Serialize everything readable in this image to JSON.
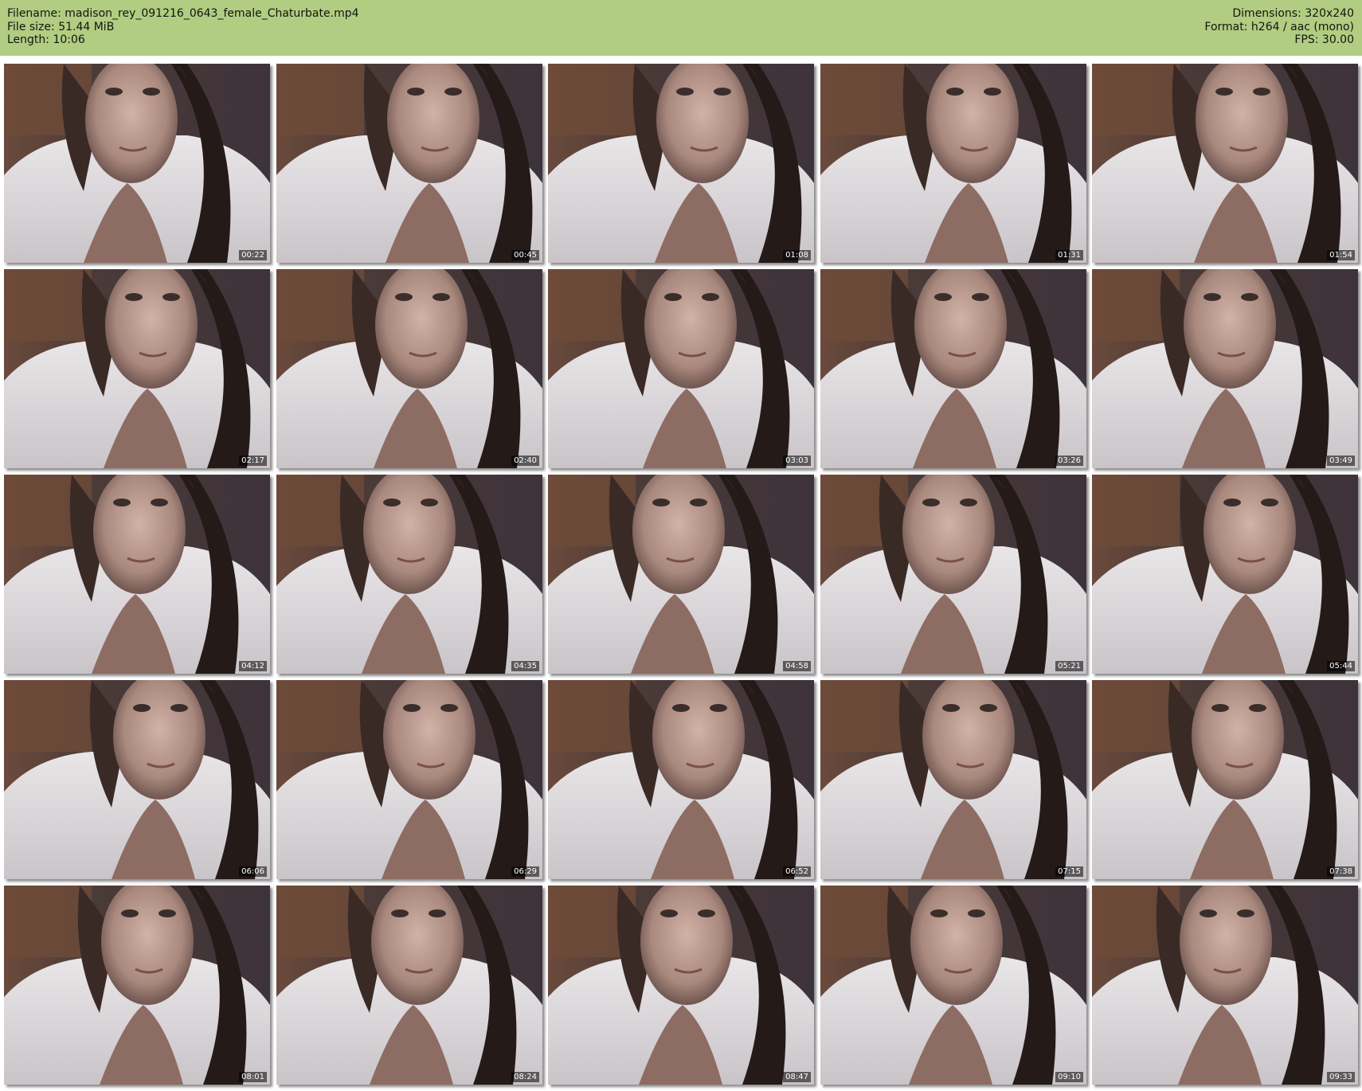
{
  "header": {
    "background": "#b0cd81",
    "left_lines": [
      "Filename: madison_rey_091216_0643_female_Chaturbate.mp4",
      "File size: 51.44 MiB",
      "Length: 10:06"
    ],
    "right_lines": [
      "Dimensions: 320x240",
      "Format: h264 / aac (mono)",
      "FPS: 30.00"
    ]
  },
  "thumbnails": [
    {
      "timestamp": "00:22"
    },
    {
      "timestamp": "00:45"
    },
    {
      "timestamp": "01:08"
    },
    {
      "timestamp": "01:31"
    },
    {
      "timestamp": "01:54"
    },
    {
      "timestamp": "02:17"
    },
    {
      "timestamp": "02:40"
    },
    {
      "timestamp": "03:03"
    },
    {
      "timestamp": "03:26"
    },
    {
      "timestamp": "03:49"
    },
    {
      "timestamp": "04:12"
    },
    {
      "timestamp": "04:35"
    },
    {
      "timestamp": "04:58"
    },
    {
      "timestamp": "05:21"
    },
    {
      "timestamp": "05:44"
    },
    {
      "timestamp": "06:06"
    },
    {
      "timestamp": "06:29"
    },
    {
      "timestamp": "06:52"
    },
    {
      "timestamp": "07:15"
    },
    {
      "timestamp": "07:38"
    },
    {
      "timestamp": "08:01"
    },
    {
      "timestamp": "08:24"
    },
    {
      "timestamp": "08:47"
    },
    {
      "timestamp": "09:10"
    },
    {
      "timestamp": "09:33"
    }
  ]
}
